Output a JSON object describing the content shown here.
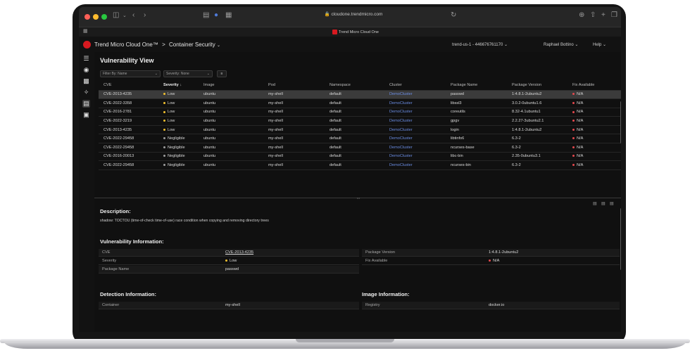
{
  "browser": {
    "url": "cloudone.trendmicro.com",
    "tab_title": "Trend Micro Cloud One"
  },
  "header": {
    "brand": "Trend Micro Cloud One™",
    "separator": ">",
    "product": "Container Security",
    "region": "trend-us-1 - 446676761170",
    "user": "Raphael Bottino",
    "help": "Help"
  },
  "view": {
    "title": "Vulnerability View",
    "filter_key": "Filter By: Name",
    "filter_value": "Severity: None"
  },
  "table": {
    "columns": [
      "CVE",
      "Severity",
      "Image",
      "Pod",
      "Namespace",
      "Cluster",
      "Package Name",
      "Package Version",
      "Fix Available"
    ],
    "rows": [
      {
        "cve": "CVE-2013-4235",
        "severity": "Low",
        "image": "ubuntu",
        "pod": "my-shell",
        "namespace": "default",
        "cluster": "DemoCluster",
        "package": "passwd",
        "version": "1:4.8.1-2ubuntu2",
        "fix": "N/A"
      },
      {
        "cve": "CVE-2022-3358",
        "severity": "Low",
        "image": "ubuntu",
        "pod": "my-shell",
        "namespace": "default",
        "cluster": "DemoCluster",
        "package": "libssl3",
        "version": "3.0.2-0ubuntu1.6",
        "fix": "N/A"
      },
      {
        "cve": "CVE-2016-2781",
        "severity": "Low",
        "image": "ubuntu",
        "pod": "my-shell",
        "namespace": "default",
        "cluster": "DemoCluster",
        "package": "coreutils",
        "version": "8.32-4.1ubuntu1",
        "fix": "N/A"
      },
      {
        "cve": "CVE-2022-3219",
        "severity": "Low",
        "image": "ubuntu",
        "pod": "my-shell",
        "namespace": "default",
        "cluster": "DemoCluster",
        "package": "gpgv",
        "version": "2.2.27-3ubuntu2.1",
        "fix": "N/A"
      },
      {
        "cve": "CVE-2013-4235",
        "severity": "Low",
        "image": "ubuntu",
        "pod": "my-shell",
        "namespace": "default",
        "cluster": "DemoCluster",
        "package": "login",
        "version": "1:4.8.1-2ubuntu2",
        "fix": "N/A"
      },
      {
        "cve": "CVE-2022-29458",
        "severity": "Negligible",
        "image": "ubuntu",
        "pod": "my-shell",
        "namespace": "default",
        "cluster": "DemoCluster",
        "package": "libtinfo6",
        "version": "6.3-2",
        "fix": "N/A"
      },
      {
        "cve": "CVE-2022-29458",
        "severity": "Negligible",
        "image": "ubuntu",
        "pod": "my-shell",
        "namespace": "default",
        "cluster": "DemoCluster",
        "package": "ncurses-base",
        "version": "6.3-2",
        "fix": "N/A"
      },
      {
        "cve": "CVE-2016-20013",
        "severity": "Negligible",
        "image": "ubuntu",
        "pod": "my-shell",
        "namespace": "default",
        "cluster": "DemoCluster",
        "package": "libc-bin",
        "version": "2.35-0ubuntu3.1",
        "fix": "N/A"
      },
      {
        "cve": "CVE-2022-29458",
        "severity": "Negligible",
        "image": "ubuntu",
        "pod": "my-shell",
        "namespace": "default",
        "cluster": "DemoCluster",
        "package": "ncurses-bin",
        "version": "6.3-2",
        "fix": "N/A"
      }
    ]
  },
  "details": {
    "description_title": "Description:",
    "description": "shadow: TOCTOU (time-of-check time-of-use) race condition when copying and removing directory trees",
    "vuln_info_title": "Vulnerability Information:",
    "vuln_info": {
      "cve_label": "CVE",
      "cve_value": "CVE-2013-4235",
      "severity_label": "Severity",
      "severity_value": "Low",
      "package_label": "Package Name",
      "package_value": "passwd",
      "version_label": "Package Version",
      "version_value": "1:4.8.1-2ubuntu2",
      "fix_label": "Fix Available",
      "fix_value": "N/A"
    },
    "detection_title": "Detection Information:",
    "detection": {
      "container_label": "Container",
      "container_value": "my-shell"
    },
    "image_title": "Image Information:",
    "image": {
      "registry_label": "Registry",
      "registry_value": "docker.io"
    }
  },
  "colors": {
    "low": "#f2c12e",
    "negligible": "#9e9e9e",
    "fix_na": "#e5484d",
    "link": "#6b8de3",
    "brand_red": "#d71920"
  }
}
